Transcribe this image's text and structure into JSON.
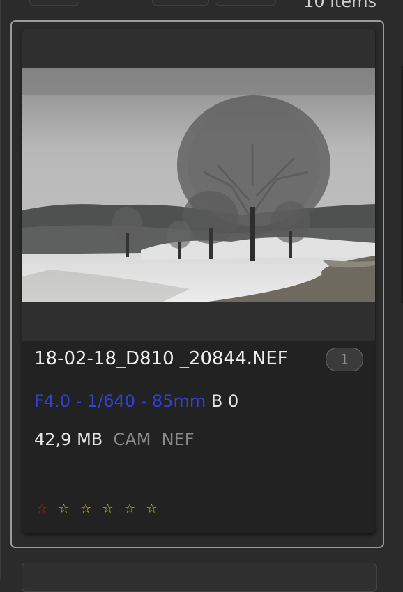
{
  "header": {
    "items_count": "10 items"
  },
  "card": {
    "filename": "18-02-18_D810 _20844.NEF",
    "version_badge": "1",
    "exif": {
      "aperture_shutter": "F4.0 - 1/640 - ",
      "focal": "85mm",
      "bracket": "B 0"
    },
    "meta": {
      "size": "42,9 MB",
      "source": "CAM",
      "format": "NEF"
    },
    "rating": {
      "reject_icon": "☆",
      "star_icon": "☆",
      "stars_total": 5
    },
    "thumbnail": {
      "description_icon": "photo-thumbnail"
    }
  },
  "colors": {
    "exif_blue": "#3040e0",
    "reject_red": "#c01818",
    "star_yellow": "#d4c414"
  }
}
